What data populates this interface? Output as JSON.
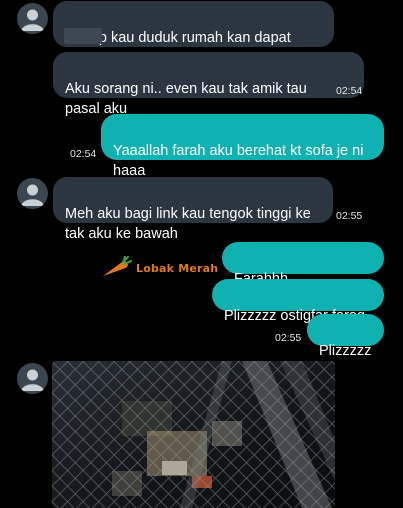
{
  "messages": {
    "m1": {
      "text": "Sedap kau duduk rumah kan dapat"
    },
    "m2": {
      "text": "Aku sorang ni.. even kau tak amik tau\npasal aku",
      "time": "02:54"
    },
    "m3": {
      "text": "Yaaallah farah aku berehat kt sofa je ni\nhaaa",
      "time": "02:54"
    },
    "m4": {
      "text": "Meh aku bagi link kau tengok tinggi ke\ntak aku ke bawah",
      "time": "02:55"
    },
    "m5": {
      "text": "Farahhh stopppppppp"
    },
    "m6": {
      "text": "Plizzzzz ostigfar farag"
    },
    "m7": {
      "text": "Plizzzzz",
      "time": "02:55"
    }
  },
  "watermark": {
    "text": "Lobak Merah",
    "icon": "carrot-icon"
  },
  "colors": {
    "background": "#000000",
    "incoming_bubble": "#2b3641",
    "outgoing_bubble": "#0fb2b1",
    "watermark": "#e07a1c"
  }
}
